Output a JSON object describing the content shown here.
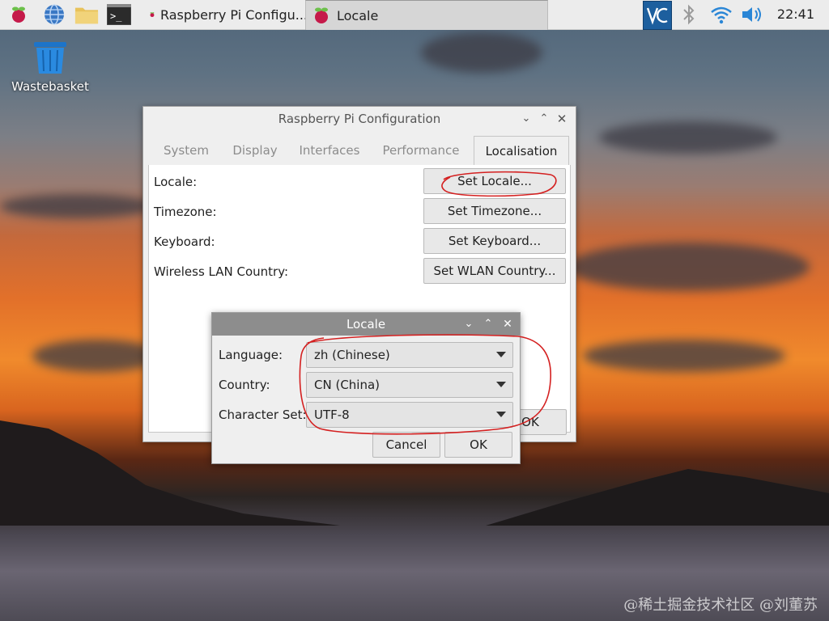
{
  "taskbar": {
    "tasks": [
      {
        "label": "Raspberry Pi Configu...",
        "active": false
      },
      {
        "label": "Locale",
        "active": true
      }
    ],
    "clock": "22:41"
  },
  "desktop": {
    "wastebasket_label": "Wastebasket"
  },
  "config_window": {
    "title": "Raspberry Pi Configuration",
    "tabs": [
      "System",
      "Display",
      "Interfaces",
      "Performance",
      "Localisation"
    ],
    "active_tab": "Localisation",
    "rows": [
      {
        "label": "Locale:",
        "button": "Set Locale..."
      },
      {
        "label": "Timezone:",
        "button": "Set Timezone..."
      },
      {
        "label": "Keyboard:",
        "button": "Set Keyboard..."
      },
      {
        "label": "Wireless LAN Country:",
        "button": "Set WLAN Country..."
      }
    ],
    "ok_label": "OK"
  },
  "locale_dialog": {
    "title": "Locale",
    "fields": [
      {
        "label": "Language:",
        "value": "zh (Chinese)"
      },
      {
        "label": "Country:",
        "value": "CN (China)"
      },
      {
        "label": "Character Set:",
        "value": "UTF-8"
      }
    ],
    "cancel_label": "Cancel",
    "ok_label": "OK"
  },
  "watermark": "@稀土掘金技术社区 @刘董苏",
  "colors": {
    "annotation": "#d42020",
    "dialog_title_bg": "#8d8d8d",
    "vnc_blue": "#1d5f9e"
  }
}
